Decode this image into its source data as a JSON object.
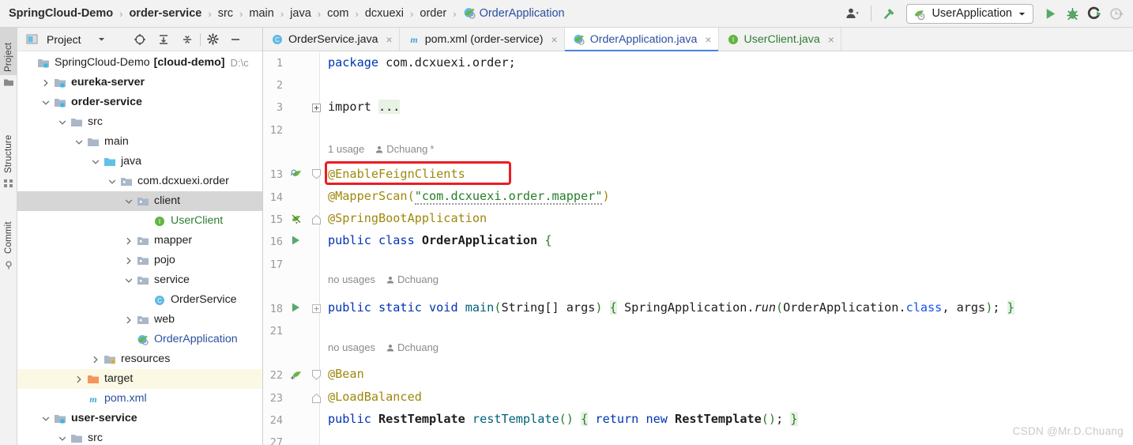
{
  "breadcrumb": {
    "name": "breadcrumb",
    "items": [
      {
        "label": "SpringCloud-Demo",
        "style": "bold"
      },
      {
        "label": "order-service",
        "style": "bold"
      },
      {
        "label": "src",
        "style": "plain"
      },
      {
        "label": "main",
        "style": "plain"
      },
      {
        "label": "java",
        "style": "plain"
      },
      {
        "label": "com",
        "style": "plain"
      },
      {
        "label": "dcxuexi",
        "style": "plain"
      },
      {
        "label": "order",
        "style": "plain"
      },
      {
        "label": "OrderApplication",
        "style": "link",
        "icon": "spring-boot-class-icon"
      }
    ],
    "separator": "›"
  },
  "toolbar": {
    "account_icon": "user-account-icon",
    "account_dropdown_icon": "chevron-down-icon",
    "build_icon": "hammer-build-icon",
    "run_config": {
      "icon": "spring-boot-run-config-icon",
      "label": "UserApplication",
      "dropdown_icon": "chevron-down-icon"
    },
    "run_icon": "run-play-icon",
    "debug_icon": "debug-bug-icon",
    "run_coverage_icon": "run-with-coverage-icon",
    "profiler_icon": "profiler-icon"
  },
  "rail": {
    "items": [
      {
        "label": "Project",
        "icon": "project-icon",
        "selected": true
      },
      {
        "label": "Structure",
        "icon": "structure-icon",
        "selected": false
      },
      {
        "label": "Commit",
        "icon": "commit-icon",
        "selected": false
      }
    ]
  },
  "project_panel": {
    "title": "Project",
    "title_icon": "project-window-icon",
    "title_dropdown_icon": "chevron-down-icon",
    "actions": [
      {
        "name": "locate-file-icon",
        "label": "Select Opened File"
      },
      {
        "name": "expand-all-icon",
        "label": "Expand All"
      },
      {
        "name": "collapse-all-icon",
        "label": "Collapse All"
      },
      {
        "name": "settings-gear-icon",
        "label": "Settings"
      },
      {
        "name": "hide-minimize-icon",
        "label": "Hide"
      }
    ],
    "tree": [
      {
        "label": "SpringCloud-Demo",
        "suffix": "[cloud-demo]",
        "path": "D:\\c",
        "indent": 0,
        "arrow": "none",
        "icon": "module-root-icon",
        "style": "plain",
        "state": "normal"
      },
      {
        "label": "eureka-server",
        "indent": 1,
        "arrow": "collapsed",
        "icon": "module-icon",
        "style": "bold",
        "state": "normal"
      },
      {
        "label": "order-service",
        "indent": 1,
        "arrow": "expanded",
        "icon": "module-icon",
        "style": "bold",
        "state": "normal"
      },
      {
        "label": "src",
        "indent": 2,
        "arrow": "expanded",
        "icon": "folder-icon",
        "style": "plain",
        "state": "normal"
      },
      {
        "label": "main",
        "indent": 3,
        "arrow": "expanded",
        "icon": "folder-icon",
        "style": "plain",
        "state": "normal"
      },
      {
        "label": "java",
        "indent": 4,
        "arrow": "expanded",
        "icon": "source-folder-icon",
        "style": "plain",
        "state": "normal"
      },
      {
        "label": "com.dcxuexi.order",
        "indent": 5,
        "arrow": "expanded",
        "icon": "package-icon",
        "style": "plain",
        "state": "normal"
      },
      {
        "label": "client",
        "indent": 6,
        "arrow": "expanded",
        "icon": "package-icon",
        "style": "plain",
        "state": "selected"
      },
      {
        "label": "UserClient",
        "indent": 7,
        "arrow": "none",
        "icon": "interface-icon",
        "style": "green",
        "state": "normal"
      },
      {
        "label": "mapper",
        "indent": 6,
        "arrow": "collapsed",
        "icon": "package-icon",
        "style": "plain",
        "state": "normal"
      },
      {
        "label": "pojo",
        "indent": 6,
        "arrow": "collapsed",
        "icon": "package-icon",
        "style": "plain",
        "state": "normal"
      },
      {
        "label": "service",
        "indent": 6,
        "arrow": "expanded",
        "icon": "package-icon",
        "style": "plain",
        "state": "normal"
      },
      {
        "label": "OrderService",
        "indent": 7,
        "arrow": "none",
        "icon": "class-icon",
        "style": "plain",
        "state": "normal"
      },
      {
        "label": "web",
        "indent": 6,
        "arrow": "collapsed",
        "icon": "package-icon",
        "style": "plain",
        "state": "normal"
      },
      {
        "label": "OrderApplication",
        "indent": 6,
        "arrow": "none",
        "icon": "spring-boot-class-icon",
        "style": "blue",
        "state": "normal"
      },
      {
        "label": "resources",
        "indent": 4,
        "arrow": "collapsed",
        "icon": "resources-folder-icon",
        "style": "plain",
        "state": "normal"
      },
      {
        "label": "target",
        "indent": 3,
        "arrow": "collapsed",
        "icon": "excluded-folder-icon",
        "style": "plain",
        "state": "highlighted"
      },
      {
        "label": "pom.xml",
        "indent": 3,
        "arrow": "none",
        "icon": "maven-icon",
        "style": "blue",
        "state": "normal"
      },
      {
        "label": "user-service",
        "indent": 1,
        "arrow": "expanded",
        "icon": "module-icon",
        "style": "bold",
        "state": "normal"
      },
      {
        "label": "src",
        "indent": 2,
        "arrow": "expanded",
        "icon": "folder-icon",
        "style": "plain",
        "state": "normal"
      }
    ]
  },
  "editor_tabs": [
    {
      "label": "OrderService.java",
      "icon": "class-icon",
      "color": "dark",
      "active": false,
      "close_icon": "close-icon"
    },
    {
      "label": "pom.xml (order-service)",
      "icon": "maven-icon",
      "color": "dark",
      "active": false,
      "close_icon": "close-icon"
    },
    {
      "label": "OrderApplication.java",
      "icon": "spring-boot-class-icon",
      "color": "blue",
      "active": true,
      "close_icon": "close-icon"
    },
    {
      "label": "UserClient.java",
      "icon": "interface-icon",
      "color": "green",
      "active": false,
      "close_icon": "close-icon"
    }
  ],
  "code": {
    "line_numbers": [
      "1",
      "2",
      "3",
      "12",
      "13",
      "14",
      "15",
      "16",
      "17",
      "18",
      "21",
      "22",
      "23",
      "24",
      "27"
    ],
    "hints": [
      {
        "usages": "1 usage",
        "author": "Dchuang",
        "suffix": "*",
        "author_icon": "author-person-icon"
      },
      {
        "usages": "no usages",
        "author": "Dchuang",
        "suffix": "",
        "author_icon": "author-person-icon"
      },
      {
        "usages": "no usages",
        "author": "Dchuang",
        "suffix": "",
        "author_icon": "author-person-icon"
      }
    ],
    "lines": [
      {
        "n": "1",
        "text": "package com.dcxuexi.order;"
      },
      {
        "n": "3",
        "text": "import ..."
      },
      {
        "n": "13",
        "text": "@EnableFeignClients"
      },
      {
        "n": "14",
        "text": "@MapperScan(\"com.dcxuexi.order.mapper\")"
      },
      {
        "n": "15",
        "text": "@SpringBootApplication"
      },
      {
        "n": "16",
        "text": "public class OrderApplication {"
      },
      {
        "n": "18",
        "text": "public static void main(String[] args) { SpringApplication.run(OrderApplication.class, args); }"
      },
      {
        "n": "22",
        "text": "@Bean"
      },
      {
        "n": "23",
        "text": "@LoadBalanced"
      },
      {
        "n": "24",
        "text": "public RestTemplate restTemplate() { return new RestTemplate(); }"
      }
    ],
    "gutter_icons": [
      {
        "line": "13",
        "name": "spring-bean-search-icon"
      },
      {
        "line": "15",
        "name": "spring-boot-config-icon"
      },
      {
        "line": "16",
        "name": "run-class-gutter-icon"
      },
      {
        "line": "18",
        "name": "run-method-gutter-icon"
      },
      {
        "line": "22",
        "name": "spring-bean-gutter-icon"
      }
    ],
    "annotation_highlight": {
      "name": "enable-feign-clients-highlight",
      "target": "@EnableFeignClients",
      "color": "#ed1c24"
    }
  },
  "watermark": "CSDN @Mr.D.Chuang",
  "colors": {
    "accent_blue": "#2b4f9e",
    "keyword": "#0033b3",
    "annotation": "#9e880d",
    "string": "#267d2b",
    "method": "#00627a",
    "highlight_red": "#ed1c24",
    "green_run": "#59a869",
    "selection_gray": "#d6d6d6",
    "target_highlight": "#fbf9e4"
  }
}
